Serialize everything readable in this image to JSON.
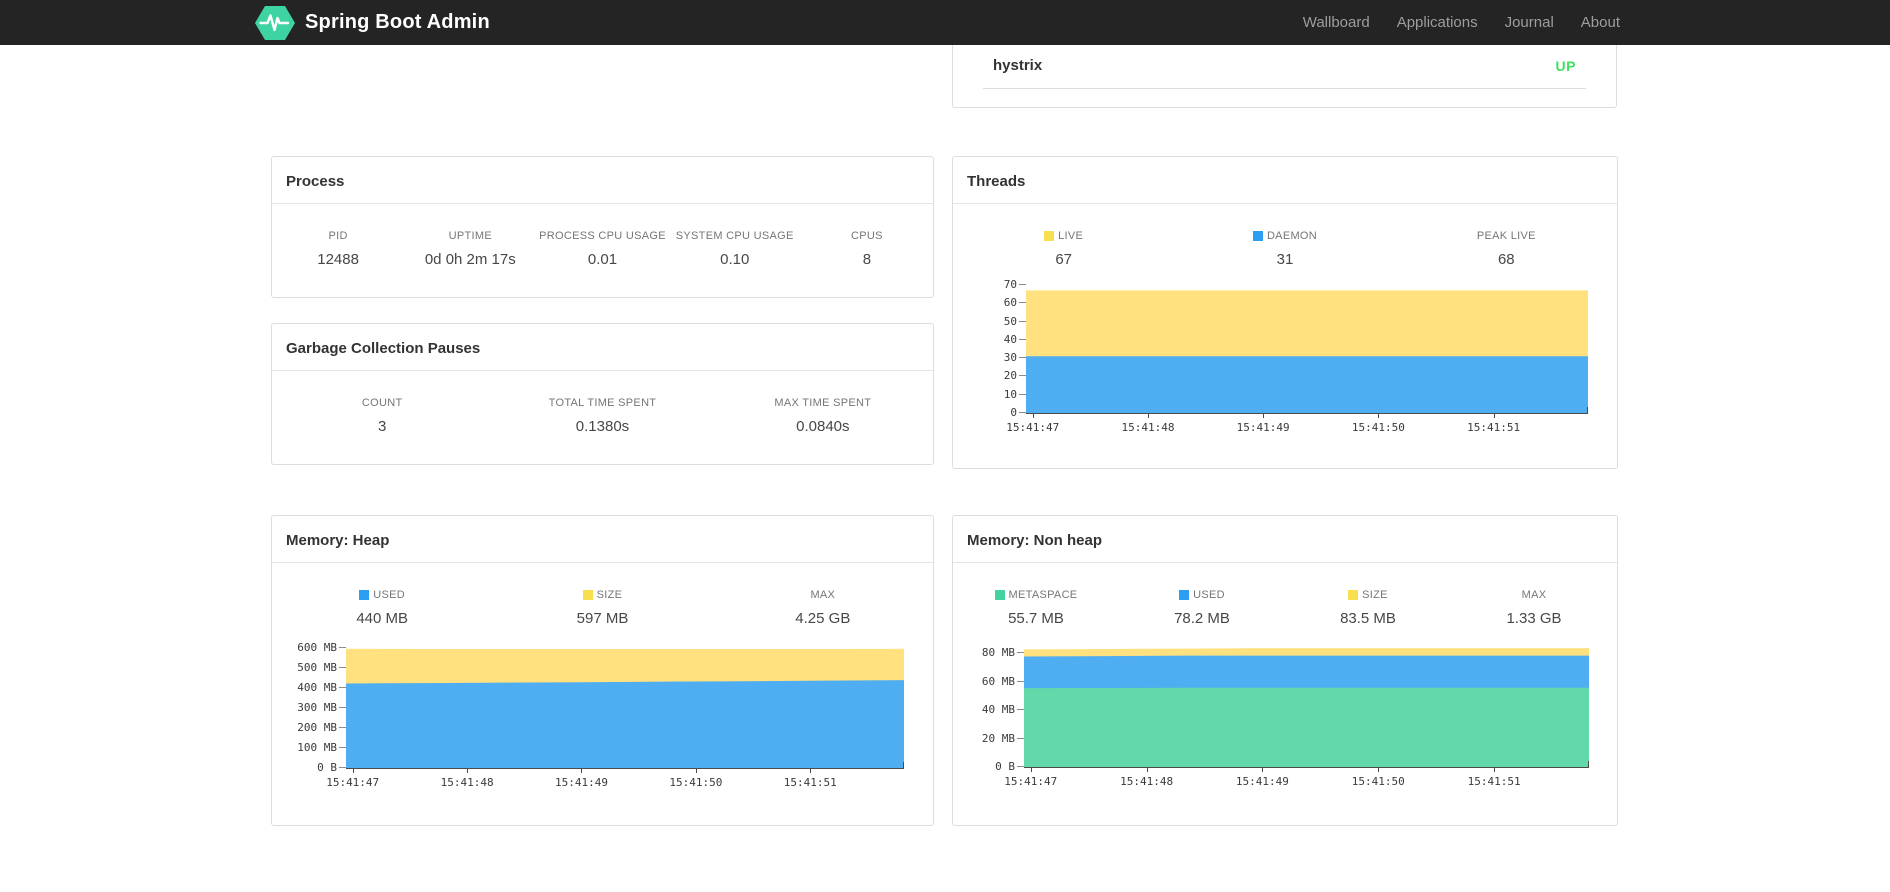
{
  "navbar": {
    "brand": "Spring Boot Admin",
    "logo_color": "#3ed3a3",
    "links": [
      {
        "label": "Wallboard"
      },
      {
        "label": "Applications"
      },
      {
        "label": "Journal"
      },
      {
        "label": "About"
      }
    ]
  },
  "application_row": {
    "name": "hystrix",
    "status": "UP",
    "status_color": "#3be35f"
  },
  "panels": {
    "process": {
      "title": "Process",
      "stats": [
        {
          "label": "PID",
          "value": "12488"
        },
        {
          "label": "UPTIME",
          "value": "0d 0h 2m 17s"
        },
        {
          "label": "PROCESS CPU USAGE",
          "value": "0.01"
        },
        {
          "label": "SYSTEM CPU USAGE",
          "value": "0.10"
        },
        {
          "label": "CPUS",
          "value": "8"
        }
      ]
    },
    "gc": {
      "title": "Garbage Collection Pauses",
      "stats": [
        {
          "label": "COUNT",
          "value": "3"
        },
        {
          "label": "TOTAL TIME SPENT",
          "value": "0.1380s"
        },
        {
          "label": "MAX TIME SPENT",
          "value": "0.0840s"
        }
      ]
    },
    "threads": {
      "title": "Threads",
      "stats": [
        {
          "label": "LIVE",
          "value": "67",
          "swatch": "#f9de4f"
        },
        {
          "label": "DAEMON",
          "value": "31",
          "swatch": "#2d9ff2"
        },
        {
          "label": "PEAK LIVE",
          "value": "68"
        }
      ]
    },
    "heap": {
      "title": "Memory: Heap",
      "stats": [
        {
          "label": "USED",
          "value": "440 MB",
          "swatch": "#2d9ff2"
        },
        {
          "label": "SIZE",
          "value": "597 MB",
          "swatch": "#f9de4f"
        },
        {
          "label": "MAX",
          "value": "4.25 GB"
        }
      ]
    },
    "nonheap": {
      "title": "Memory: Non heap",
      "stats": [
        {
          "label": "METASPACE",
          "value": "55.7 MB",
          "swatch": "#43d39e"
        },
        {
          "label": "USED",
          "value": "78.2 MB",
          "swatch": "#2d9ff2"
        },
        {
          "label": "SIZE",
          "value": "83.5 MB",
          "swatch": "#f9de4f"
        },
        {
          "label": "MAX",
          "value": "1.33 GB"
        }
      ]
    }
  },
  "chart_data": {
    "threads": {
      "type": "area",
      "stacked": true,
      "legend_position": "top",
      "x_labels": [
        "15:41:47",
        "15:41:48",
        "15:41:49",
        "15:41:50",
        "15:41:51"
      ],
      "ymax": 70.5,
      "yticks": [
        {
          "v": 0,
          "label": "0"
        },
        {
          "v": 10,
          "label": "10"
        },
        {
          "v": 20,
          "label": "20"
        },
        {
          "v": 30,
          "label": "30"
        },
        {
          "v": 40,
          "label": "40"
        },
        {
          "v": 50,
          "label": "50"
        },
        {
          "v": 60,
          "label": "60"
        },
        {
          "v": 70,
          "label": "70"
        }
      ],
      "series": [
        {
          "name": "live",
          "color": "#ffe180",
          "tops": [
            67,
            67,
            67,
            67,
            67,
            67
          ]
        },
        {
          "name": "daemon",
          "color": "#4fadf1",
          "tops": [
            31,
            31,
            31,
            31,
            31,
            31
          ]
        }
      ]
    },
    "heap": {
      "type": "area",
      "stacked": true,
      "legend_position": "top",
      "x_labels": [
        "15:41:47",
        "15:41:48",
        "15:41:49",
        "15:41:50",
        "15:41:51"
      ],
      "ymax": 612,
      "yticks": [
        {
          "v": 0,
          "label": "0 B"
        },
        {
          "v": 100,
          "label": "100 MB"
        },
        {
          "v": 200,
          "label": "200 MB"
        },
        {
          "v": 300,
          "label": "300 MB"
        },
        {
          "v": 400,
          "label": "400 MB"
        },
        {
          "v": 500,
          "label": "500 MB"
        },
        {
          "v": 600,
          "label": "600 MB"
        }
      ],
      "series": [
        {
          "name": "size",
          "color": "#ffe180",
          "tops": [
            598,
            597,
            597,
            597,
            597,
            597,
            597,
            598
          ]
        },
        {
          "name": "used",
          "color": "#4fadf1",
          "tops": [
            424,
            426,
            428,
            430,
            433,
            435,
            438,
            441
          ]
        }
      ]
    },
    "nonheap": {
      "type": "area",
      "stacked": true,
      "legend_position": "top",
      "x_labels": [
        "15:41:47",
        "15:41:48",
        "15:41:49",
        "15:41:50",
        "15:41:51"
      ],
      "ymax": 85,
      "yticks": [
        {
          "v": 0,
          "label": "0 B"
        },
        {
          "v": 20,
          "label": "20 MB"
        },
        {
          "v": 40,
          "label": "40 MB"
        },
        {
          "v": 60,
          "label": "60 MB"
        },
        {
          "v": 80,
          "label": "80 MB"
        }
      ],
      "series": [
        {
          "name": "size",
          "color": "#ffe180",
          "tops": [
            82.6,
            82.9,
            83.2,
            83.5,
            83.5,
            83.5,
            83.5,
            83.5
          ]
        },
        {
          "name": "used",
          "color": "#4fadf1",
          "tops": [
            77.6,
            77.9,
            78.2,
            78.2,
            78.2,
            78.2,
            78.2,
            78.2
          ]
        },
        {
          "name": "metaspace",
          "color": "#62d8ab",
          "tops": [
            55.4,
            55.5,
            55.7,
            55.7,
            55.7,
            55.7,
            55.7,
            55.7
          ]
        }
      ]
    }
  }
}
